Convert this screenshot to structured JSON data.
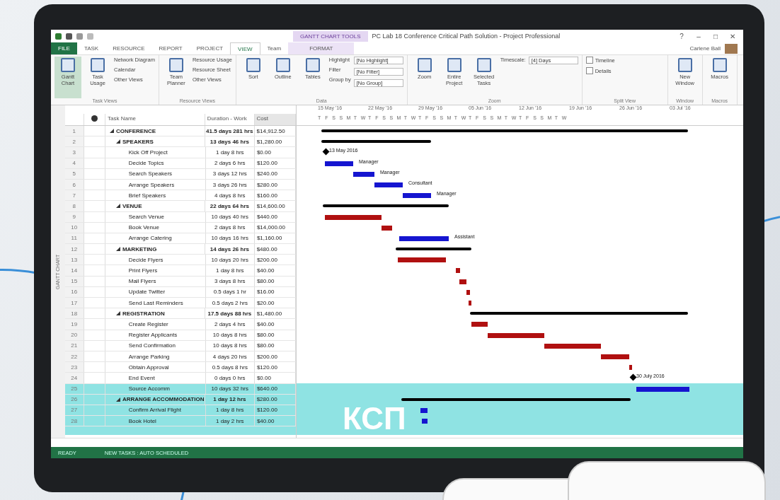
{
  "window": {
    "context_label": "GANTT CHART TOOLS",
    "title": "PC Lab 18 Conference Critical Path Solution - Project Professional",
    "controls": [
      "?",
      "–",
      "□",
      "✕"
    ]
  },
  "tabs": [
    {
      "label": "FILE",
      "selected": false,
      "kind": "file"
    },
    {
      "label": "TASK",
      "selected": false,
      "kind": "tab"
    },
    {
      "label": "RESOURCE",
      "selected": false,
      "kind": "tab"
    },
    {
      "label": "REPORT",
      "selected": false,
      "kind": "tab"
    },
    {
      "label": "PROJECT",
      "selected": false,
      "kind": "tab"
    },
    {
      "label": "VIEW",
      "selected": true,
      "kind": "tab"
    },
    {
      "label": "Team",
      "selected": false,
      "kind": "tab"
    },
    {
      "label": "FORMAT",
      "selected": false,
      "kind": "context"
    }
  ],
  "account": {
    "name": "Carlene Ball"
  },
  "ribbon": [
    {
      "label": "Task Views",
      "large": [
        {
          "label": "Gantt Chart",
          "selected": true
        },
        {
          "label": "Task Usage",
          "selected": false
        }
      ],
      "small": [
        "Network Diagram",
        "Calendar",
        "Other Views"
      ]
    },
    {
      "label": "Resource Views",
      "large": [
        {
          "label": "Team Planner",
          "selected": false
        }
      ],
      "small": [
        "Resource Usage",
        "Resource Sheet",
        "Other Views"
      ]
    },
    {
      "label": "Data",
      "large": [
        {
          "label": "Sort",
          "selected": false
        },
        {
          "label": "Outline",
          "selected": false
        },
        {
          "label": "Tables",
          "selected": false
        }
      ],
      "small": [
        "Highlight",
        "Filter",
        "Group by"
      ],
      "fields": [
        "[No Highlight]",
        "[No Filter]",
        "[No Group]"
      ]
    },
    {
      "label": "Zoom",
      "large": [
        {
          "label": "Zoom",
          "selected": false
        },
        {
          "label": "Entire Project",
          "selected": false
        },
        {
          "label": "Selected Tasks",
          "selected": false
        }
      ],
      "small": [
        "Timescale:"
      ],
      "fields": [
        "[4] Days"
      ]
    },
    {
      "label": "Split View",
      "checks": [
        {
          "label": "Timeline",
          "checked": false
        },
        {
          "label": "Details",
          "checked": false
        }
      ]
    },
    {
      "label": "Window",
      "large": [
        {
          "label": "New Window",
          "selected": false
        }
      ]
    },
    {
      "label": "Macros",
      "large": [
        {
          "label": "Macros",
          "selected": false
        }
      ]
    }
  ],
  "side_label": "GANTT CHART",
  "table": {
    "columns": [
      "Task Name",
      "Duration - Work",
      "Cost"
    ],
    "rows": [
      {
        "id": "1",
        "name": "CONFERENCE",
        "duration": "41.5 days 281 hrs",
        "cost": "$14,912.50",
        "kind": "summary",
        "children": [
          {
            "id": "2",
            "name": "SPEAKERS",
            "duration": "13 days 46 hrs",
            "cost": "$1,280.00",
            "kind": "summary",
            "children": [
              {
                "id": "3",
                "name": "Kick Off Project",
                "duration": "1 day 8 hrs",
                "cost": "$0.00",
                "kind": "milestone",
                "bar_label": "13 May 2016"
              },
              {
                "id": "4",
                "name": "Decide Topics",
                "duration": "2 days 6 hrs",
                "cost": "$120.00",
                "kind": "task",
                "critical": false,
                "bar_label": "Manager"
              },
              {
                "id": "5",
                "name": "Search Speakers",
                "duration": "3 days 12 hrs",
                "cost": "$240.00",
                "kind": "task",
                "critical": false,
                "bar_label": "Manager"
              },
              {
                "id": "6",
                "name": "Arrange Speakers",
                "duration": "3 days 26 hrs",
                "cost": "$280.00",
                "kind": "task",
                "critical": false,
                "bar_label": "Consultant"
              },
              {
                "id": "7",
                "name": "Brief Speakers",
                "duration": "4 days 8 hrs",
                "cost": "$160.00",
                "kind": "task",
                "critical": false,
                "bar_label": "Manager"
              }
            ]
          },
          {
            "id": "8",
            "name": "VENUE",
            "duration": "22 days 64 hrs",
            "cost": "$14,600.00",
            "kind": "summary",
            "children": [
              {
                "id": "9",
                "name": "Search Venue",
                "duration": "10 days 40 hrs",
                "cost": "$440.00",
                "kind": "task",
                "critical": true
              },
              {
                "id": "10",
                "name": "Book Venue",
                "duration": "2 days 8 hrs",
                "cost": "$14,000.00",
                "kind": "task",
                "critical": true
              },
              {
                "id": "11",
                "name": "Arrange Catering",
                "duration": "10 days 16 hrs",
                "cost": "$1,160.00",
                "kind": "task",
                "critical": false,
                "bar_label": "Assistant"
              }
            ]
          },
          {
            "id": "12",
            "name": "MARKETING",
            "duration": "14 days 26 hrs",
            "cost": "$480.00",
            "kind": "summary",
            "children": [
              {
                "id": "13",
                "name": "Decide Flyers",
                "duration": "10 days 20 hrs",
                "cost": "$200.00",
                "kind": "task",
                "critical": true
              },
              {
                "id": "14",
                "name": "Print Flyers",
                "duration": "1 day 8 hrs",
                "cost": "$40.00",
                "kind": "task",
                "critical": true
              },
              {
                "id": "15",
                "name": "Mail Flyers",
                "duration": "3 days 8 hrs",
                "cost": "$80.00",
                "kind": "task",
                "critical": true
              },
              {
                "id": "16",
                "name": "Update Twitter",
                "duration": "0.5 days 1 hr",
                "cost": "$16.00",
                "kind": "task",
                "critical": true
              },
              {
                "id": "17",
                "name": "Send Last Reminders",
                "duration": "0.5 days 2 hrs",
                "cost": "$20.00",
                "kind": "task",
                "critical": true
              }
            ]
          },
          {
            "id": "18",
            "name": "REGISTRATION",
            "duration": "17.5 days 88 hrs",
            "cost": "$1,480.00",
            "kind": "summary",
            "children": [
              {
                "id": "19",
                "name": "Create Register",
                "duration": "2 days 4 hrs",
                "cost": "$40.00",
                "kind": "task",
                "critical": true
              },
              {
                "id": "20",
                "name": "Register Applicants",
                "duration": "10 days 8 hrs",
                "cost": "$80.00",
                "kind": "task",
                "critical": true
              },
              {
                "id": "21",
                "name": "Send Confirmation",
                "duration": "10 days 8 hrs",
                "cost": "$80.00",
                "kind": "task",
                "critical": true
              },
              {
                "id": "22",
                "name": "Arrange Parking",
                "duration": "4 days 20 hrs",
                "cost": "$200.00",
                "kind": "task",
                "critical": true
              },
              {
                "id": "23",
                "name": "Obtain Approval",
                "duration": "0.5 days 8 hrs",
                "cost": "$120.00",
                "kind": "task",
                "critical": true
              },
              {
                "id": "24",
                "name": "End Event",
                "duration": "0 days 0 hrs",
                "cost": "$0.00",
                "kind": "milestone",
                "bar_label": "30 July 2016"
              },
              {
                "id": "25",
                "name": "Source Accomm",
                "duration": "10 days 32 hrs",
                "cost": "$640.00",
                "kind": "task",
                "critical": false
              }
            ]
          },
          {
            "id": "26",
            "name": "ARRANGE ACCOMMODATION",
            "duration": "1 day 12 hrs",
            "cost": "$280.00",
            "kind": "summary",
            "children": [
              {
                "id": "27",
                "name": "Confirm Arrival Flight",
                "duration": "1 day 8 hrs",
                "cost": "$120.00",
                "kind": "task",
                "critical": false
              },
              {
                "id": "28",
                "name": "Book Hotel",
                "duration": "1 day 2 hrs",
                "cost": "$40.00",
                "kind": "task",
                "critical": false
              }
            ]
          }
        ]
      }
    ]
  },
  "timescale": {
    "weeks": [
      "15 May '16",
      "22 May '16",
      "29 May '16",
      "05 Jun '16",
      "12 Jun '16",
      "19 Jun '16",
      "26 Jun '16",
      "03 Jul '16"
    ],
    "days": [
      "T",
      "F",
      "S",
      "S",
      "M",
      "T",
      "W",
      "T",
      "F",
      "S",
      "S",
      "M",
      "T",
      "W",
      "T",
      "F",
      "S",
      "S",
      "M",
      "T",
      "W",
      "T",
      "F",
      "S",
      "S",
      "M",
      "T",
      "W",
      "T",
      "F",
      "S",
      "S",
      "M",
      "T",
      "W"
    ]
  },
  "status_bar": {
    "mode": "READY",
    "scheduling": "NEW TASKS : AUTO SCHEDULED"
  },
  "banner": {
    "text": "КСП"
  }
}
